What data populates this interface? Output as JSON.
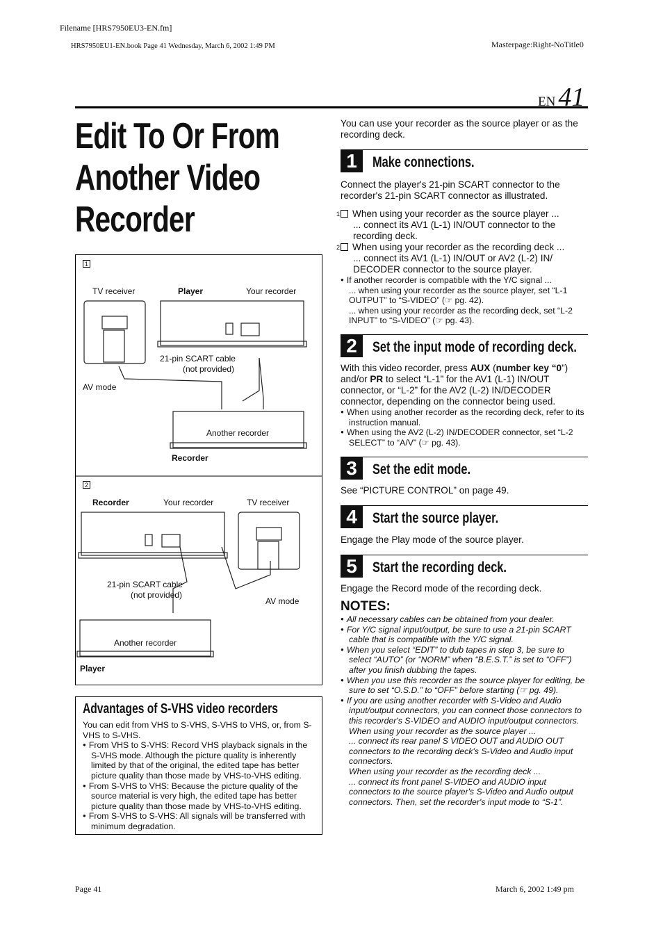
{
  "header": {
    "filename": "Filename [HRS7950EU3-EN.fm]",
    "book": "HRS7950EU1-EN.book  Page 41  Wednesday, March 6, 2002  1:49 PM",
    "masterpage": "Masterpage:Right-NoTitle0",
    "lang": "EN",
    "page_number": "41"
  },
  "title": [
    "Edit To Or From",
    "Another Video",
    "Recorder"
  ],
  "diagram1": {
    "marker": "1",
    "tv": "TV receiver",
    "player": "Player",
    "your_recorder": "Your recorder",
    "cable": "21-pin SCART cable",
    "not_provided": "(not provided)",
    "av_mode": "AV mode",
    "another": "Another recorder",
    "recorder": "Recorder"
  },
  "diagram2": {
    "marker": "2",
    "recorder": "Recorder",
    "your_recorder": "Your recorder",
    "tv": "TV receiver",
    "cable": "21-pin SCART cable",
    "not_provided": "(not provided)",
    "av_mode": "AV mode",
    "another": "Another recorder",
    "player": "Player"
  },
  "advantages": {
    "title": "Advantages of S-VHS video recorders",
    "intro": "You can edit from VHS to S-VHS, S-VHS to VHS, or, from S-VHS to S-VHS.",
    "bullets": [
      "From VHS to S-VHS: Record VHS playback signals in the S-VHS mode. Although the picture quality is inherently limited by that of the original, the edited tape has better picture quality than those made by VHS-to-VHS editing.",
      "From S-VHS to VHS: Because the picture quality of the source material is very high, the edited tape has better picture quality than those made by VHS-to-VHS editing.",
      "From S-VHS to S-VHS: All signals will be transferred with minimum degradation."
    ]
  },
  "intro": "You can use your recorder as the source player or as the recording deck.",
  "steps": [
    {
      "num": "1",
      "title": "Make connections.",
      "body": "Connect the player's 21-pin SCART connector to the recorder's 21-pin SCART connector as illustrated.",
      "items": [
        {
          "n": "1",
          "text": "When using your recorder as the source player ...",
          "sub": "... connect its AV1 (L-1) IN/OUT connector to the recording deck."
        },
        {
          "n": "2",
          "text": "When using your recorder as the recording deck ...",
          "sub": "... connect its AV1 (L-1) IN/OUT or AV2 (L-2) IN/ DECODER connector to the source player."
        }
      ],
      "bullet": "If another recorder is compatible with the Y/C signal ...",
      "bullet_sub": [
        "... when using your recorder as the source player, set “L-1 OUTPUT” to “S-VIDEO” (☞ pg. 42).",
        "... when using your recorder as the recording deck, set “L-2 INPUT” to “S-VIDEO” (☞ pg. 43)."
      ]
    },
    {
      "num": "2",
      "title": "Set the input mode of recording deck.",
      "body_parts": [
        "With this video recorder, press ",
        "AUX",
        " (",
        "number key “0",
        "”) and/or ",
        "PR",
        " to select “L-1” for the AV1 (L-1) IN/OUT connector, or “L-2” for the AV2 (L-2) IN/DECODER connector, depending on the connector being used."
      ],
      "bullets": [
        "When using another recorder as the recording deck, refer to its instruction manual.",
        "When using the AV2 (L-2) IN/DECODER connector, set “L-2 SELECT” to “A/V” (☞ pg. 43)."
      ]
    },
    {
      "num": "3",
      "title": "Set the edit mode.",
      "body": "See “PICTURE CONTROL” on page 49."
    },
    {
      "num": "4",
      "title": "Start the source player.",
      "body": "Engage the Play mode of the source player."
    },
    {
      "num": "5",
      "title": "Start the recording deck.",
      "body": "Engage the Record mode of the recording deck."
    }
  ],
  "notes": {
    "title": "NOTES:",
    "items": [
      "All necessary cables can be obtained from your dealer.",
      "For Y/C signal input/output, be sure to use a 21-pin SCART cable that is compatible with the Y/C signal.",
      "When you select “EDIT” to dub tapes in step 3, be sure to select “AUTO” (or “NORM” when “B.E.S.T.” is set to “OFF”) after you finish dubbing the tapes.",
      "When you use this recorder as the source player for editing, be sure to set “O.S.D.” to “OFF” before starting (☞ pg. 49).",
      "If you are using another recorder with S-Video and Audio input/output connectors, you can connect those connectors to this recorder's S-VIDEO and AUDIO input/output connectors.",
      "When using your recorder as the source player ...",
      "... connect its rear panel S VIDEO OUT and AUDIO OUT connectors to the recording deck's S-Video and Audio input connectors.",
      "When using your recorder as the recording deck ...",
      "... connect its front panel S-VIDEO and AUDIO input connectors to the source player's S-Video and Audio output connectors. Then, set the recorder's input mode to “S-1”."
    ]
  },
  "footer": {
    "page": "Page 41",
    "date": "March 6, 2002 1:49 pm"
  }
}
